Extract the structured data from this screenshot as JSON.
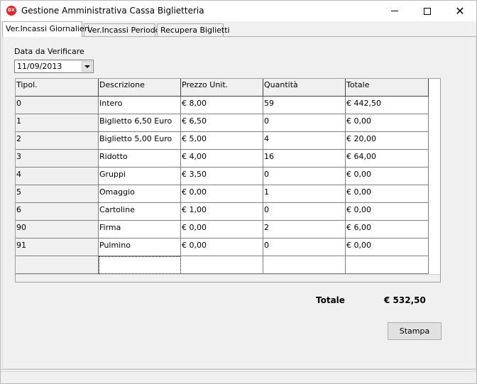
{
  "window": {
    "title": "Gestione Amministrativa Cassa Biglietteria",
    "icon_text": "DX",
    "icon_name": "app-logo-icon",
    "close_glyph": "✕"
  },
  "tabs": [
    {
      "label": "Ver.Incassi Giornalieri",
      "active": true
    },
    {
      "label": "Ver.Incassi Periodo",
      "active": false
    },
    {
      "label": "Recupera Biglietti",
      "active": false
    }
  ],
  "date_picker": {
    "label": "Data da Verificare",
    "value": "11/09/2013"
  },
  "grid": {
    "columns": [
      "Tipol.",
      "Descrizione",
      "Prezzo Unit.",
      "Quantità",
      "Totale"
    ],
    "rows": [
      [
        "0",
        "Intero",
        "€ 8,00",
        "59",
        "€ 442,50"
      ],
      [
        "1",
        "Biglietto 6,50 Euro",
        "€ 6,50",
        "0",
        "€ 0,00"
      ],
      [
        "2",
        "Biglietto 5,00 Euro",
        "€ 5,00",
        "4",
        "€ 20,00"
      ],
      [
        "3",
        "Ridotto",
        "€ 4,00",
        "16",
        "€ 64,00"
      ],
      [
        "4",
        "Gruppi",
        "€ 3,50",
        "0",
        "€ 0,00"
      ],
      [
        "5",
        "Omaggio",
        "€ 0,00",
        "1",
        "€ 0,00"
      ],
      [
        "6",
        "Cartoline",
        "€ 1,00",
        "0",
        "€ 0,00"
      ],
      [
        "90",
        "Firma",
        "€ 0,00",
        "2",
        "€ 6,00"
      ],
      [
        "91",
        "Pulmino",
        "€ 0,00",
        "0",
        "€ 0,00"
      ],
      [
        "",
        "",
        "",
        "",
        ""
      ]
    ]
  },
  "summary": {
    "total_label": "Totale",
    "total_value": "€ 532,50"
  },
  "actions": {
    "print_label": "Stampa"
  },
  "colors": {
    "icon_bg": "#e0262b",
    "window_bg": "#f0f0f0"
  }
}
